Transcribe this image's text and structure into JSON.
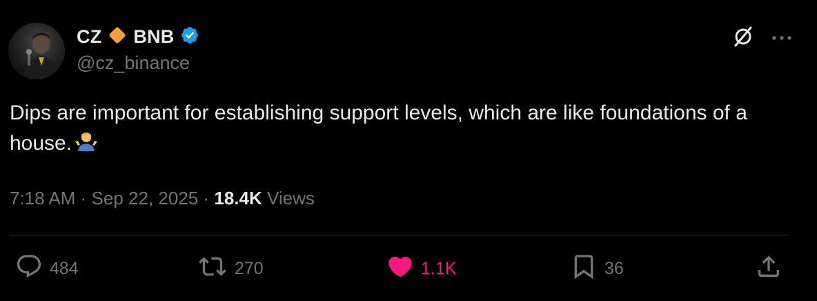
{
  "author": {
    "display_name_first": "CZ",
    "display_name_second": "BNB",
    "handle": "@cz_binance",
    "verified": true
  },
  "tweet": {
    "text": "Dips are important for establishing support levels, which are like foundations of a house.",
    "emoji": "person-shrugging"
  },
  "meta": {
    "time": "7:18 AM",
    "separator": "·",
    "date": "Sep 22, 2025",
    "views_count": "18.4K",
    "views_label": "Views"
  },
  "actions": {
    "replies": "484",
    "reposts": "270",
    "likes": "1.1K",
    "bookmarks": "36",
    "liked": true
  },
  "colors": {
    "background": "#000000",
    "text_primary": "#e7e9ea",
    "text_secondary": "#71767b",
    "verified": "#1d9bf0",
    "like": "#f91880",
    "bnb_diamond": "#f0a03c",
    "divider": "#2f3336"
  },
  "icons": [
    "grok-icon",
    "more-icon",
    "reply-icon",
    "repost-icon",
    "like-icon",
    "bookmark-icon",
    "share-icon",
    "verified-badge-icon",
    "bnb-diamond-icon"
  ]
}
